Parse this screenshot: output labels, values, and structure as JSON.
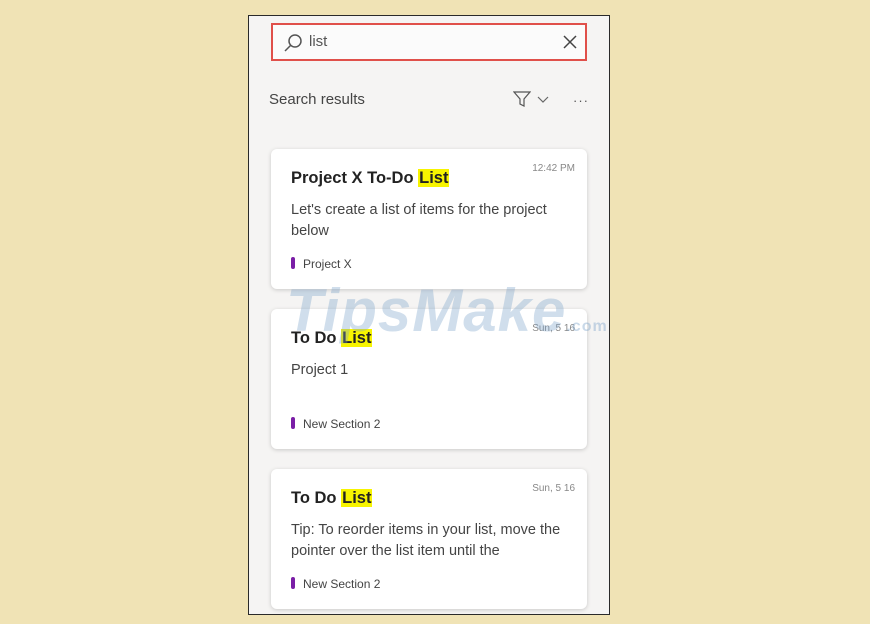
{
  "search": {
    "query": "list"
  },
  "results": {
    "label": "Search results",
    "more": "···"
  },
  "cards": [
    {
      "time": "12:42 PM",
      "title_prefix": "Project X To-Do ",
      "title_highlight": "List",
      "preview": "Let's create a list of items for the project below",
      "section": "Project X"
    },
    {
      "time": "Sun, 5 16",
      "title_prefix": "To Do ",
      "title_highlight": "List",
      "preview": "Project 1",
      "section": "New Section 2"
    },
    {
      "time": "Sun, 5 16",
      "title_prefix": "To Do ",
      "title_highlight": "List",
      "preview": "Tip:  To reorder items in your list, move the pointer over the list item until the",
      "section": "New Section 2"
    }
  ],
  "watermark": {
    "brand": "TipsMake",
    "suffix": ".com"
  },
  "colors": {
    "background": "#f0e3b5",
    "search_border": "#e0504a",
    "highlight": "#f7f400",
    "section_marker": "#7a1ea6"
  }
}
